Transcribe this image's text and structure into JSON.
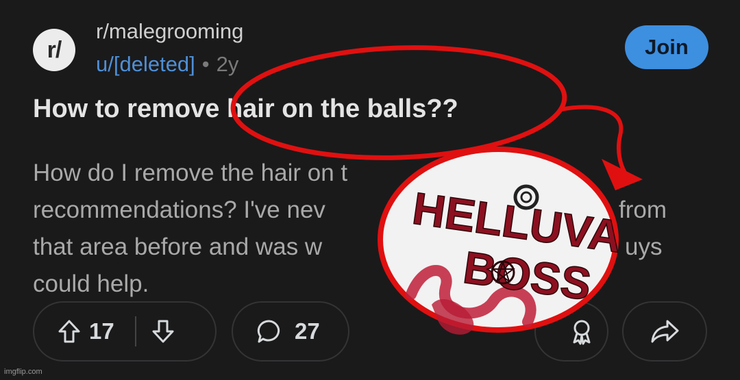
{
  "post": {
    "community_avatar_text": "r/",
    "community": "r/malegrooming",
    "author": "u/[deleted]",
    "separator": "•",
    "age": "2y",
    "join_label": "Join",
    "title": "How to remove hair on the balls??",
    "body_lines": [
      "How do I remove the hair on t",
      "recommendations? I've nev",
      "that area before and was w",
      "could help."
    ],
    "body_fragments": [
      "from",
      "uys"
    ]
  },
  "actions": {
    "upvotes": "17",
    "comments": "27"
  },
  "overlay": {
    "logo_line1": "HELLUVA",
    "logo_line2": "BOSS",
    "colors": {
      "circle": "#e01010",
      "logo_red": "#a01224",
      "logo_bg": "#f2f2f2"
    }
  },
  "watermark": "imgflip.com"
}
